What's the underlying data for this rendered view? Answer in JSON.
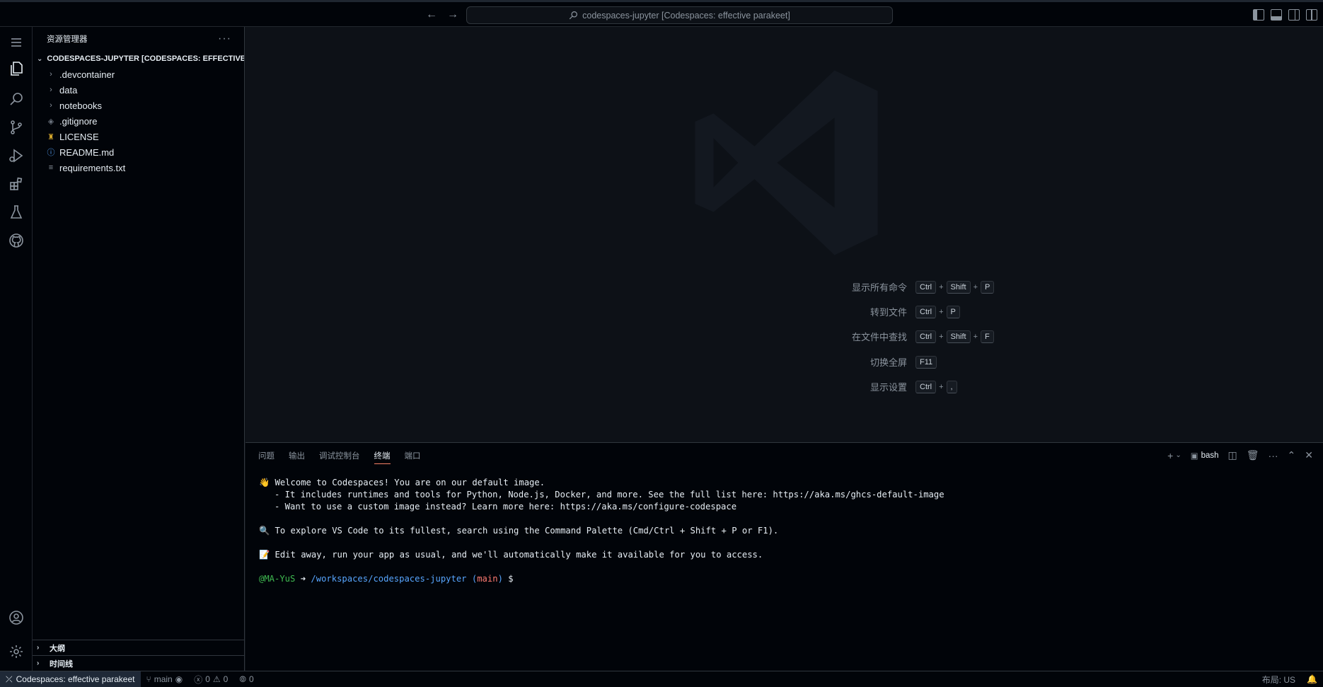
{
  "titlebar": {
    "back": "←",
    "forward": "→",
    "command_center": "codespaces-jupyter [Codespaces: effective parakeet]"
  },
  "sidebar": {
    "title": "资源管理器",
    "more": "···",
    "root": "CODESPACES-JUPYTER [CODESPACES: EFFECTIVE P...",
    "items": [
      {
        "label": ".devcontainer",
        "icon": "chevron-right"
      },
      {
        "label": "data",
        "icon": "chevron-right"
      },
      {
        "label": "notebooks",
        "icon": "chevron-right"
      },
      {
        "label": ".gitignore",
        "icon": "git-diamond"
      },
      {
        "label": "LICENSE",
        "icon": "license-ribbon"
      },
      {
        "label": "README.md",
        "icon": "info"
      },
      {
        "label": "requirements.txt",
        "icon": "lines"
      }
    ],
    "outline": "大纲",
    "timeline": "时间线"
  },
  "shortcuts": [
    {
      "label": "显示所有命令",
      "keys": [
        "Ctrl",
        "Shift",
        "P"
      ]
    },
    {
      "label": "转到文件",
      "keys": [
        "Ctrl",
        "P"
      ]
    },
    {
      "label": "在文件中查找",
      "keys": [
        "Ctrl",
        "Shift",
        "F"
      ]
    },
    {
      "label": "切换全屏",
      "keys": [
        "F11"
      ]
    },
    {
      "label": "显示设置",
      "keys": [
        "Ctrl",
        ","
      ]
    }
  ],
  "panel": {
    "tabs": [
      "问题",
      "输出",
      "调试控制台",
      "终端",
      "端口"
    ],
    "active_tab": "终端",
    "shell": "bash",
    "plus": "+",
    "more": "···"
  },
  "terminal": {
    "line1": "👋 Welcome to Codespaces! You are on our default image.",
    "line2": "   - It includes runtimes and tools for Python, Node.js, Docker, and more. See the full list here: https://aka.ms/ghcs-default-image",
    "line3": "   - Want to use a custom image instead? Learn more here: https://aka.ms/configure-codespace",
    "line4": "🔍 To explore VS Code to its fullest, search using the Command Palette (Cmd/Ctrl + Shift + P or F1).",
    "line5": "📝 Edit away, run your app as usual, and we'll automatically make it available for you to access.",
    "prompt_user": "@MA-YuS",
    "prompt_arrow": " ➜ ",
    "prompt_path": "/workspaces/codespaces-jupyter",
    "prompt_branch_open": " (",
    "prompt_branch": "main",
    "prompt_branch_close": ") ",
    "prompt_symbol": "$"
  },
  "statusbar": {
    "remote": "Codespaces: effective parakeet",
    "branch": "main",
    "errors": "0",
    "warnings": "0",
    "ports": "0",
    "layout": "布局: US"
  },
  "colors": {
    "background": "#0d1117",
    "sidebar_bg": "#010409",
    "accent_tab": "#f78166",
    "prompt_green": "#3fb950",
    "prompt_blue": "#58a6ff",
    "branch_red": "#ff7b72"
  }
}
